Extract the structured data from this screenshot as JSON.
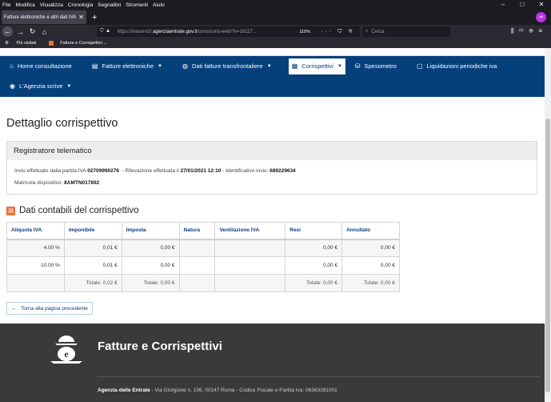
{
  "browser": {
    "menu": [
      "File",
      "Modifica",
      "Visualizza",
      "Cronologia",
      "Segnalibri",
      "Strumenti",
      "Aiuto"
    ],
    "tab_title": "Fatture elettroniche e altri dati IVA",
    "url_prefix": "https://ivaservizi.",
    "url_domain": "agenziaentrate.gov.it",
    "url_path": "/cons/cons-web/?v=16117...",
    "zoom": "110%",
    "search_placeholder": "Cerca",
    "bookmarks": [
      "Più visitati",
      "Fatture e Corrispettivi ..."
    ]
  },
  "nav": {
    "items": [
      {
        "label": "Home consultazione",
        "icon": "⌂",
        "caret": ""
      },
      {
        "label": "Fatture elettroniche",
        "icon": "▤",
        "caret": "▼"
      },
      {
        "label": "Dati fatture transfrontaliere",
        "icon": "◍",
        "caret": "▼"
      },
      {
        "label": "Corrispettivi",
        "icon": "▦",
        "caret": "▼"
      },
      {
        "label": "Spesometro",
        "icon": "⛁",
        "caret": ""
      },
      {
        "label": "Liquidazioni periodiche iva",
        "icon": "▢",
        "caret": ""
      },
      {
        "label": "L'Agenzia scrive",
        "icon": "◉",
        "caret": "▼"
      }
    ]
  },
  "page": {
    "title": "Dettaglio corrispettivo",
    "card_title": "Registratore telematico",
    "invio_label": "Invio effettuato dalla partita IVA",
    "partita_iva": "02709990276",
    "rilevazione_label": "- Rilevazione effettuata il",
    "rilevazione_date": "27/01/2021 12:10",
    "identificativo_label": "- Identificativo invio:",
    "identificativo": "689229634",
    "matricola_label": "Matricola dispositivo:",
    "matricola": "8AMTN017892",
    "section_title": "Dati contabili del corrispettivo",
    "back_label": "Torna alla pagina precedente"
  },
  "table": {
    "headers": [
      "Aliquota IVA",
      "Imponibile",
      "Imposta",
      "Natura",
      "Ventilazione IVA",
      "Resi",
      "Annullato"
    ],
    "rows": [
      [
        "4.00 %",
        "0,01 €",
        "0,00 €",
        "",
        "",
        "0,00 €",
        "0,00 €"
      ],
      [
        "10.00 %",
        "0,01 €",
        "0,00 €",
        "",
        "",
        "0,00 €",
        "0,00 €"
      ],
      [
        "",
        "Totale: 0,02 €",
        "Totale: 0,00 €",
        "",
        "",
        "Totale: 0,00 €",
        "Totale: 0,00 €"
      ]
    ]
  },
  "footer": {
    "title": "Fatture e Corrispettivi",
    "agency": "Agenzia delle Entrate",
    "address": " - Via Giorgione n. 106, 00147 Roma - Codice Fiscale e Partita Iva: 06363391001"
  },
  "colors": {
    "nav_blue": "#06407b",
    "accent_orange": "#e8703a",
    "footer_bg": "#3a3a3a"
  }
}
